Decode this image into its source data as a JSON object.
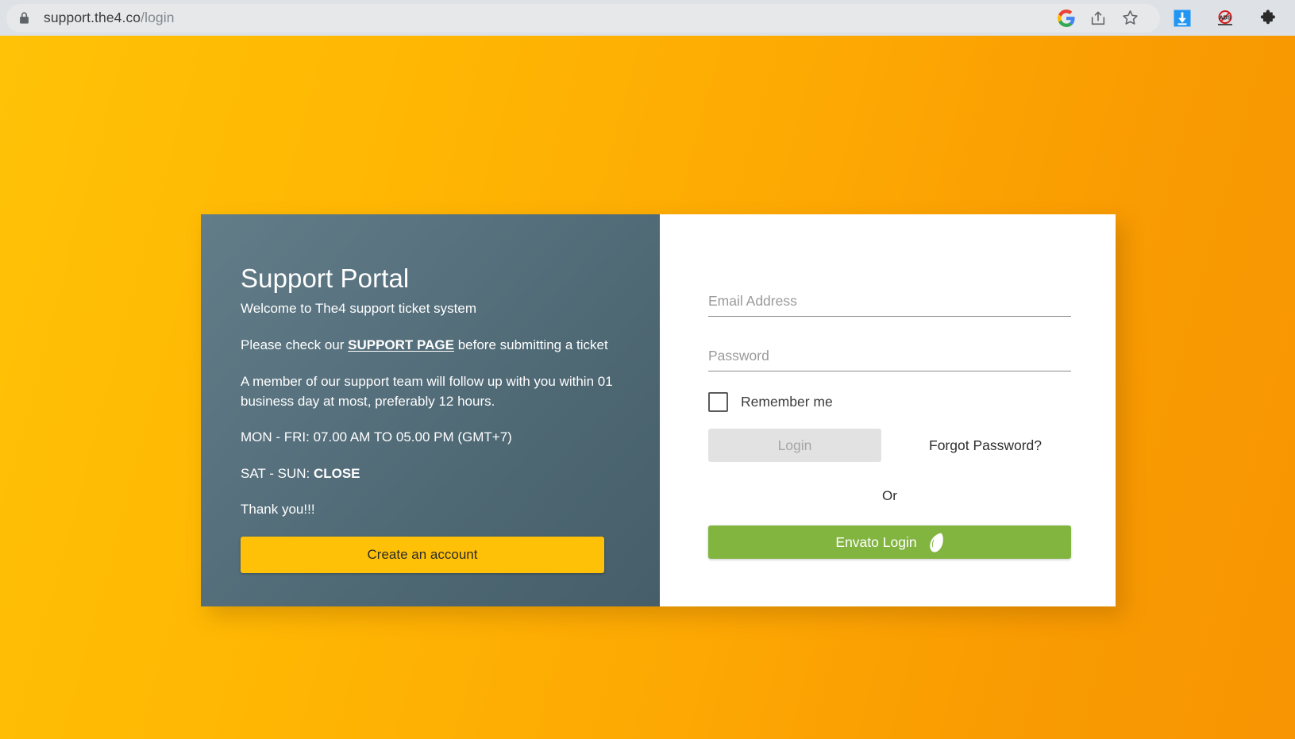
{
  "browser": {
    "url_domain": "support.the4.co",
    "url_path": "/login",
    "icons": [
      {
        "name": "lock-icon",
        "label": "Secure connection"
      },
      {
        "name": "google-icon",
        "label": "Google"
      },
      {
        "name": "share-icon",
        "label": "Share this page"
      },
      {
        "name": "bookmark-star-icon",
        "label": "Bookmark this tab"
      },
      {
        "name": "download-icon",
        "label": "Downloads"
      },
      {
        "name": "adblock-icon",
        "label": "ADS"
      },
      {
        "name": "extensions-puzzle-icon",
        "label": "Extensions"
      }
    ]
  },
  "left_panel": {
    "title": "Support Portal",
    "subtitle": "Welcome to The4 support ticket system",
    "para_support_pre": "Please check our ",
    "para_support_link": "SUPPORT PAGE",
    "para_support_post": " before submitting a ticket",
    "para_followup": "A member of our support team will follow up with you within 01 business day at most, preferably 12 hours.",
    "hours_weekday": "MON - FRI: 07.00 AM TO 05.00 PM (GMT+7)",
    "hours_weekend_pre": "SAT - SUN: ",
    "hours_weekend_value": "CLOSE",
    "thanks": "Thank you!!!",
    "create_account_label": "Create an account"
  },
  "right_panel": {
    "email_placeholder": "Email Address",
    "email_value": "",
    "password_placeholder": "Password",
    "password_value": "",
    "remember_label": "Remember me",
    "remember_checked": false,
    "login_label": "Login",
    "forgot_label": "Forgot Password?",
    "or_label": "Or",
    "envato_label": "Envato Login"
  },
  "colors": {
    "background_start": "#ffc207",
    "background_end": "#f79502",
    "panel_left_start": "#627c88",
    "panel_left_end": "#465e69",
    "accent_yellow": "#ffc107",
    "envato_green": "#82b440",
    "login_disabled": "#e2e2e2"
  }
}
